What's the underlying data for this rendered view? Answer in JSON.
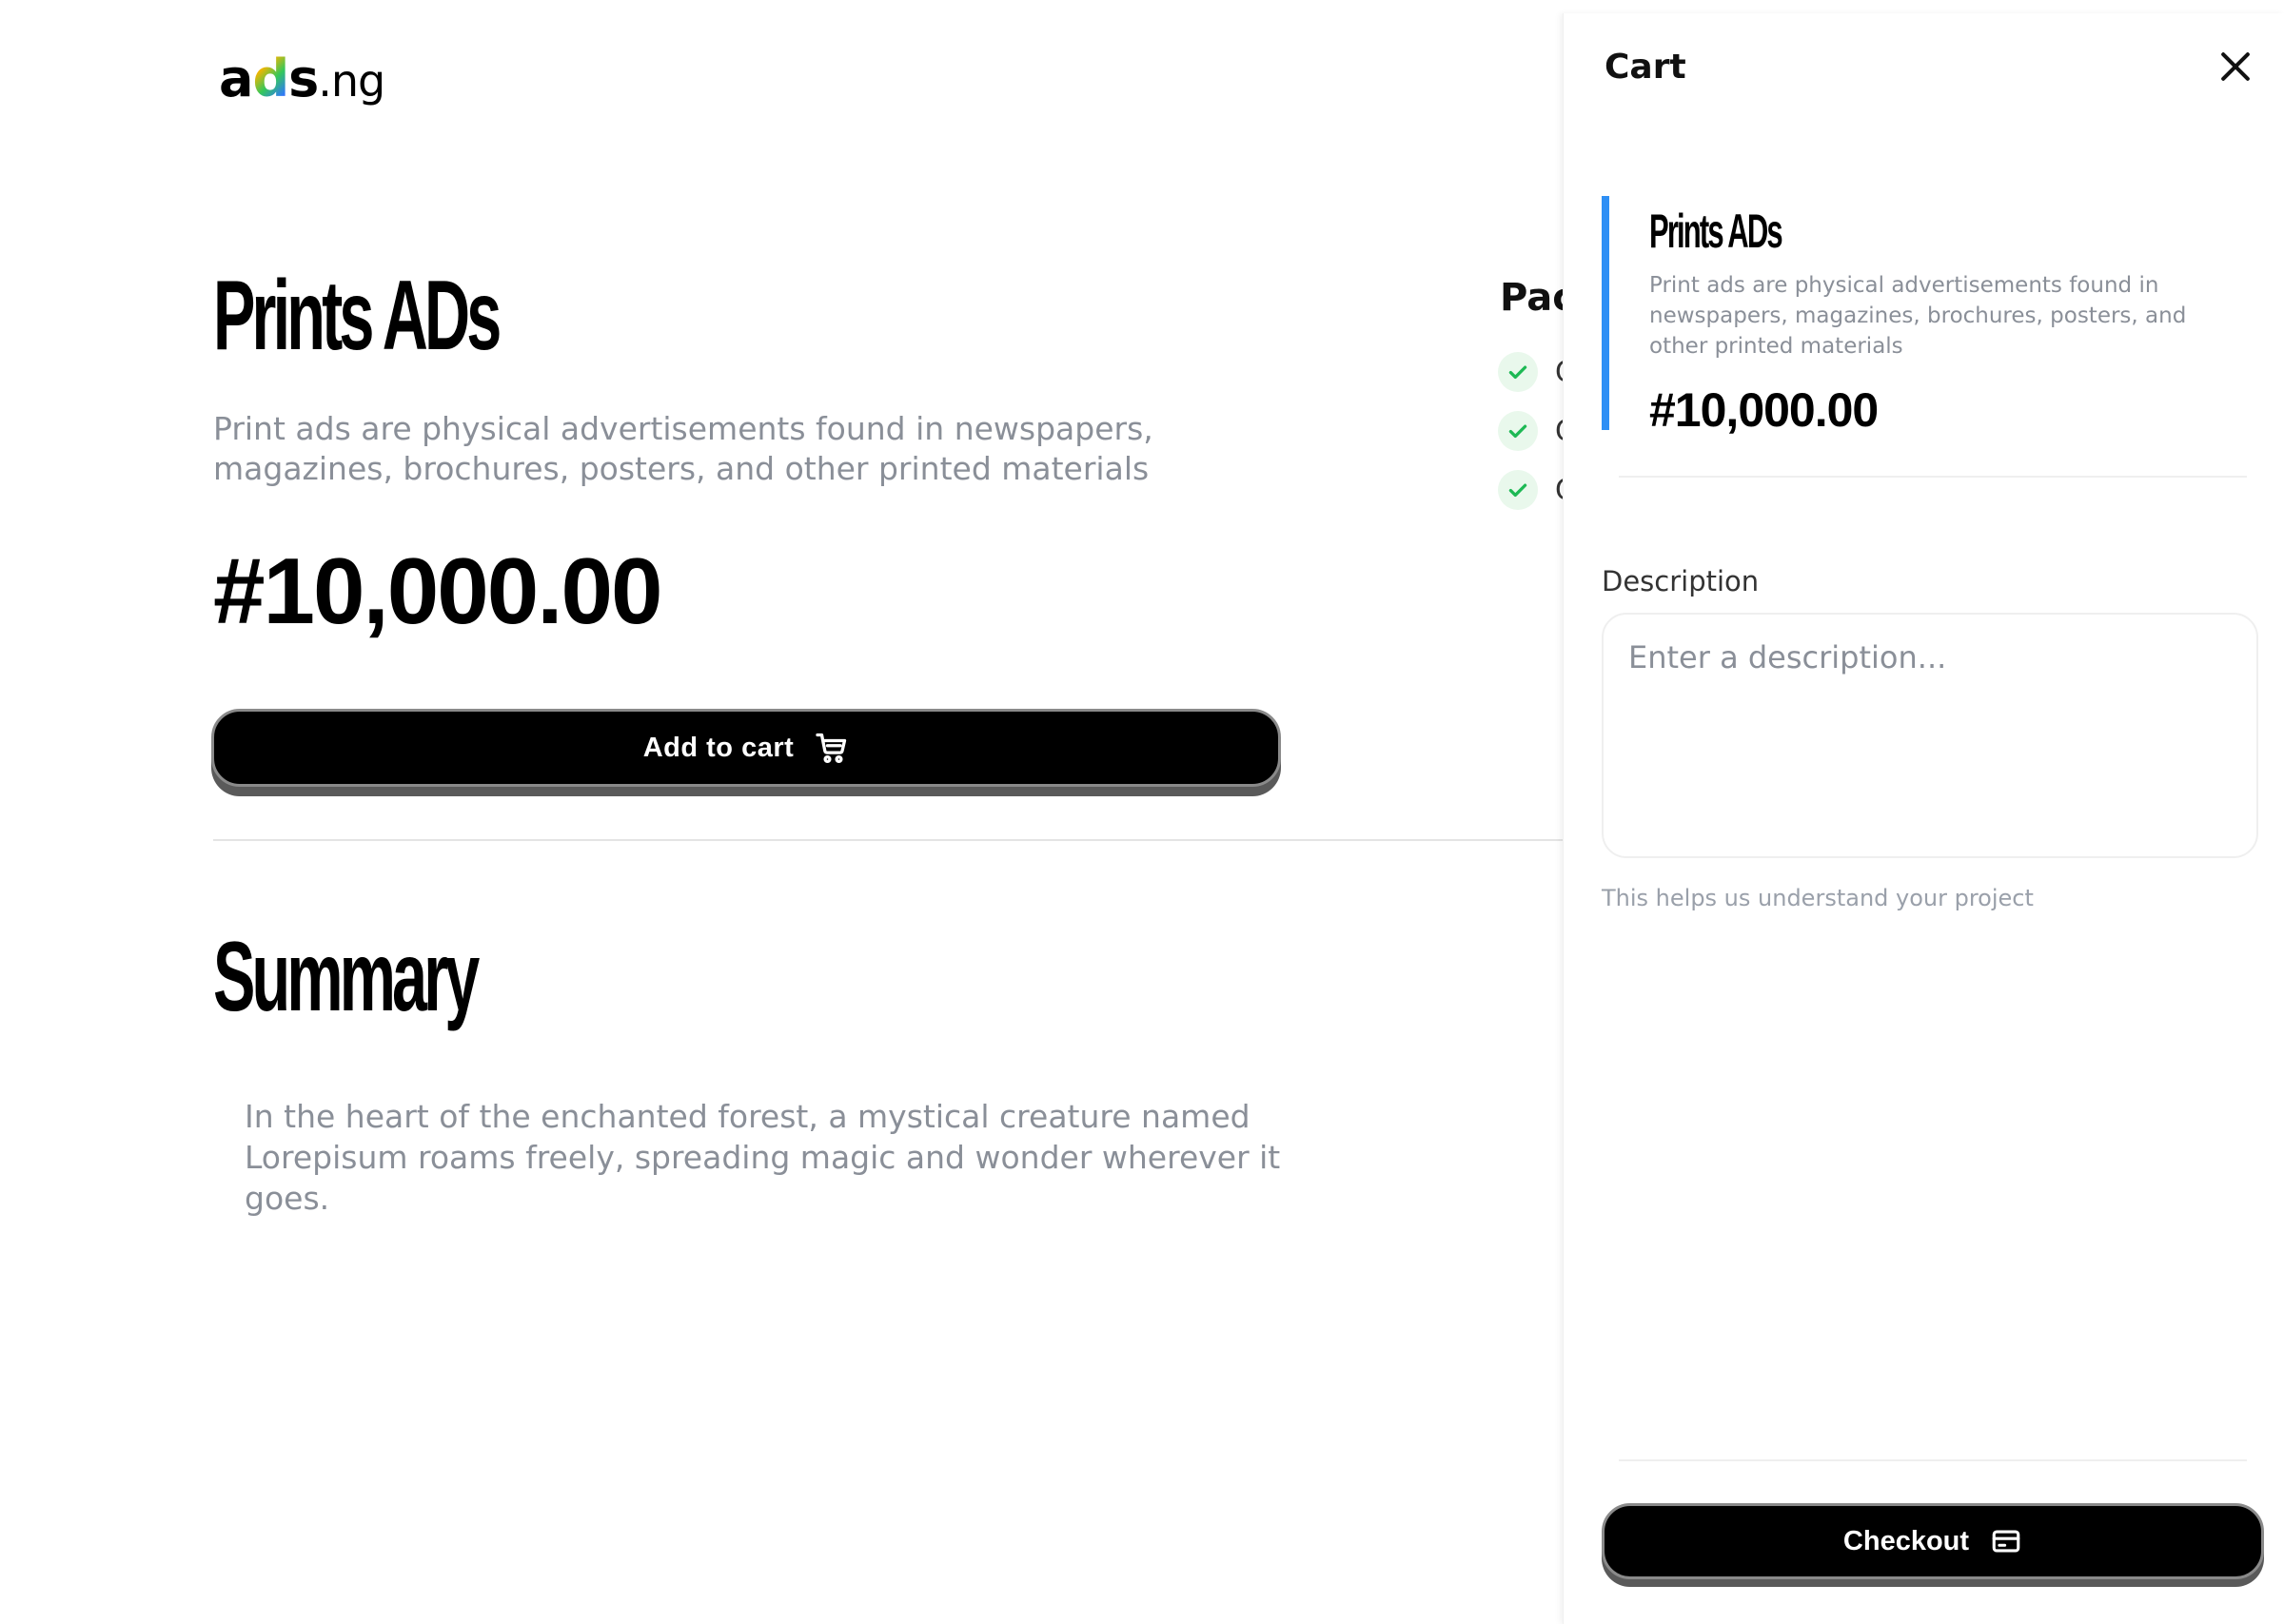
{
  "brand": {
    "logo_main": "ads",
    "logo_tld": ".ng"
  },
  "product": {
    "title": "Prints ADs",
    "description": "Print ads are physical advertisements found in newspapers, magazines, brochures, posters, and other printed materials",
    "price": "#10,000.00",
    "add_to_cart_label": "Add to cart",
    "add_to_cart_icon": "cart-icon"
  },
  "packages": {
    "title_partial": "Pac",
    "items": [
      "C",
      "C",
      "C"
    ],
    "icon": "check-icon",
    "check_color": "#1db954"
  },
  "summary": {
    "title": "Summary",
    "text": "In the heart of the enchanted forest, a mystical creature named Lorepisum roams freely, spreading magic and wonder wherever it goes."
  },
  "cart": {
    "title": "Cart",
    "close_icon": "close-icon",
    "item": {
      "title": "Prints ADs",
      "description": "Print ads are physical advertisements found in newspapers, magazines, brochures, posters, and other printed materials",
      "price": "#10,000.00",
      "accent_color": "#2e8ff5"
    },
    "description_label": "Description",
    "description_placeholder": "Enter a description...",
    "description_hint": "This helps us understand your project",
    "checkout_label": "Checkout",
    "checkout_icon": "credit-card-icon"
  }
}
